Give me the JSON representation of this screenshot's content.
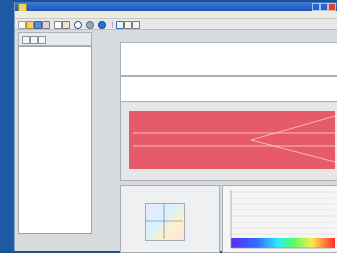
{
  "window": {
    "title": ""
  },
  "menu": [],
  "tree": [],
  "table": {
    "headers": [],
    "rows": []
  },
  "colors": {
    "plot_red": "#e65a6a",
    "titlebar": "#1d56b8",
    "spectrum_start": "#5a2cff",
    "spectrum_end": "#ff2a2a"
  },
  "icons": [
    "app-icon",
    "new-icon",
    "open-icon",
    "save-icon",
    "print-icon",
    "copy-icon",
    "paste-icon",
    "zoom-icon",
    "settings-icon",
    "help-icon"
  ]
}
